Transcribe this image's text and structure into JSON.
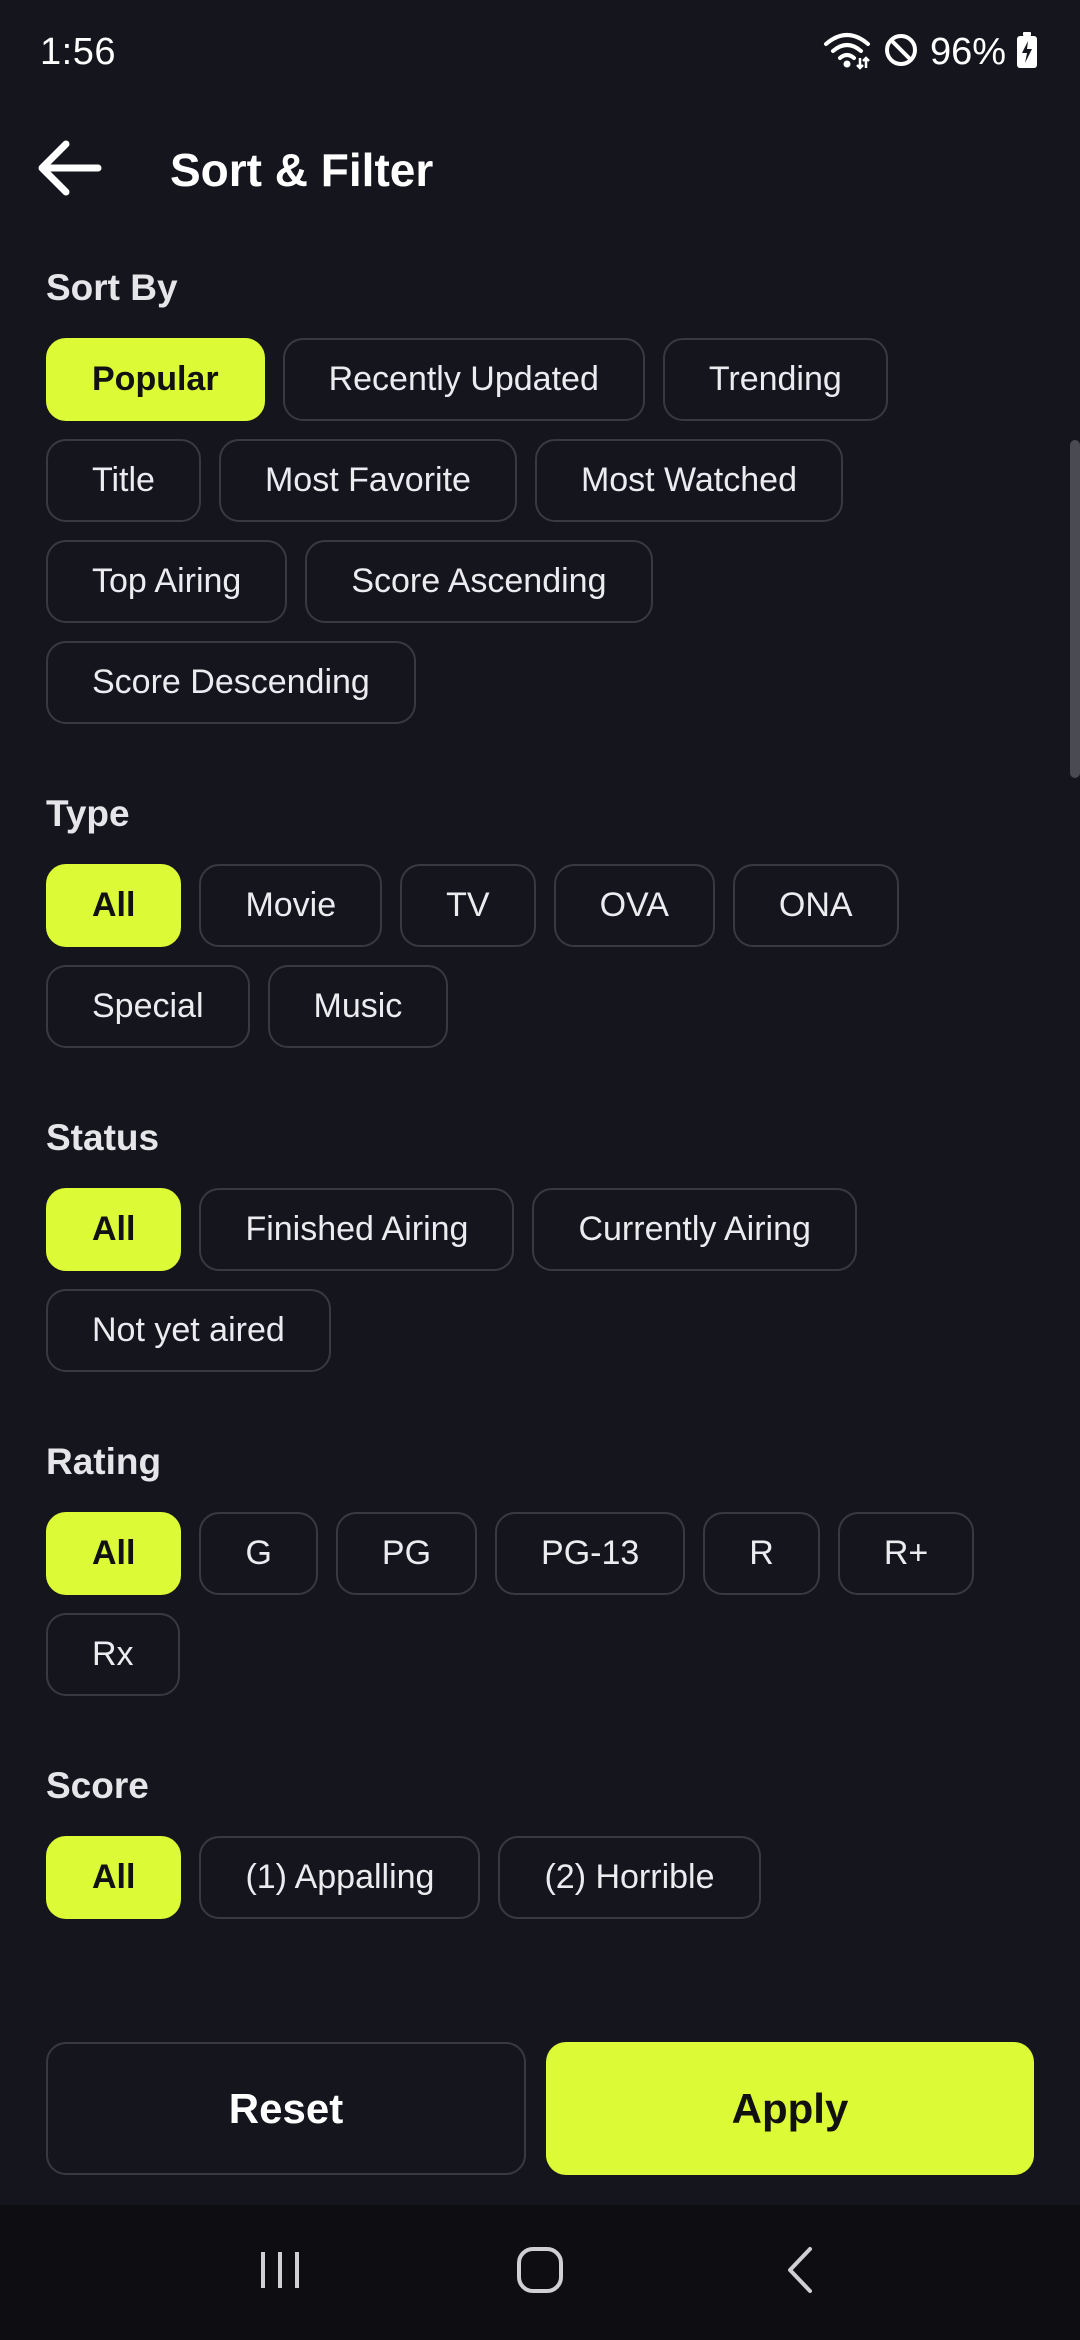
{
  "status_bar": {
    "time": "1:56",
    "battery": "96%",
    "icons": [
      "wifi-icon",
      "do-not-disturb-icon",
      "battery-charging-icon"
    ]
  },
  "app_bar": {
    "title": "Sort & Filter",
    "back_icon": "arrow-left-icon"
  },
  "accent_color": "#dcfb36",
  "sections": {
    "sort_by": {
      "title": "Sort By",
      "options": [
        "Popular",
        "Recently Updated",
        "Trending",
        "Title",
        "Most Favorite",
        "Most Watched",
        "Top Airing",
        "Score Ascending",
        "Score Descending"
      ],
      "selected": "Popular"
    },
    "type": {
      "title": "Type",
      "options": [
        "All",
        "Movie",
        "TV",
        "OVA",
        "ONA",
        "Special",
        "Music"
      ],
      "selected": "All"
    },
    "status": {
      "title": "Status",
      "options": [
        "All",
        "Finished Airing",
        "Currently Airing",
        "Not yet aired"
      ],
      "selected": "All"
    },
    "rating": {
      "title": "Rating",
      "options": [
        "All",
        "G",
        "PG",
        "PG-13",
        "R",
        "R+",
        "Rx"
      ],
      "selected": "All"
    },
    "score": {
      "title": "Score",
      "options": [
        "All",
        "(1) Appalling",
        "(2) Horrible"
      ],
      "selected": "All"
    }
  },
  "actions": {
    "reset_label": "Reset",
    "apply_label": "Apply"
  },
  "nav_bar": {
    "icons": [
      "recent-apps-icon",
      "home-icon",
      "back-icon"
    ]
  }
}
